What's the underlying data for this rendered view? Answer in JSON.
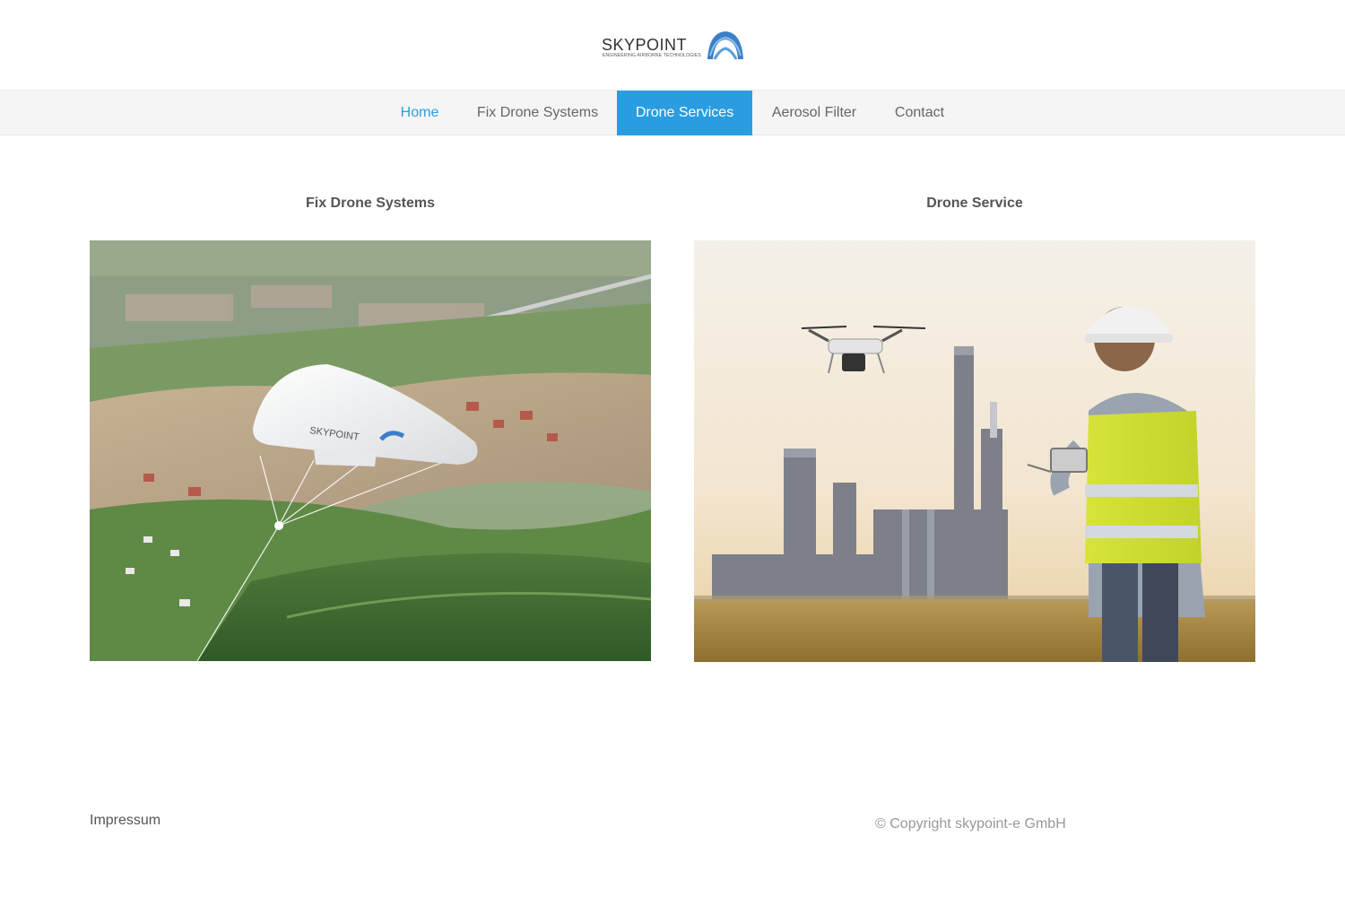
{
  "brand": {
    "name": "SKYPOINT",
    "tagline": "ENGINEERING AIRBORNE TECHNOLOGIES",
    "accent_color": "#2a9de1"
  },
  "nav": {
    "items": [
      {
        "label": "Home",
        "state": "current"
      },
      {
        "label": "Fix Drone Systems",
        "state": "default"
      },
      {
        "label": "Drone Services",
        "state": "active"
      },
      {
        "label": "Aerosol Filter",
        "state": "default"
      },
      {
        "label": "Contact",
        "state": "default"
      }
    ]
  },
  "main": {
    "columns": [
      {
        "title": "Fix Drone Systems",
        "image_label": "SKYPOINT"
      },
      {
        "title": "Drone Service"
      }
    ]
  },
  "footer": {
    "impressum": "Impressum",
    "copyright": "© Copyright skypoint-e GmbH"
  }
}
